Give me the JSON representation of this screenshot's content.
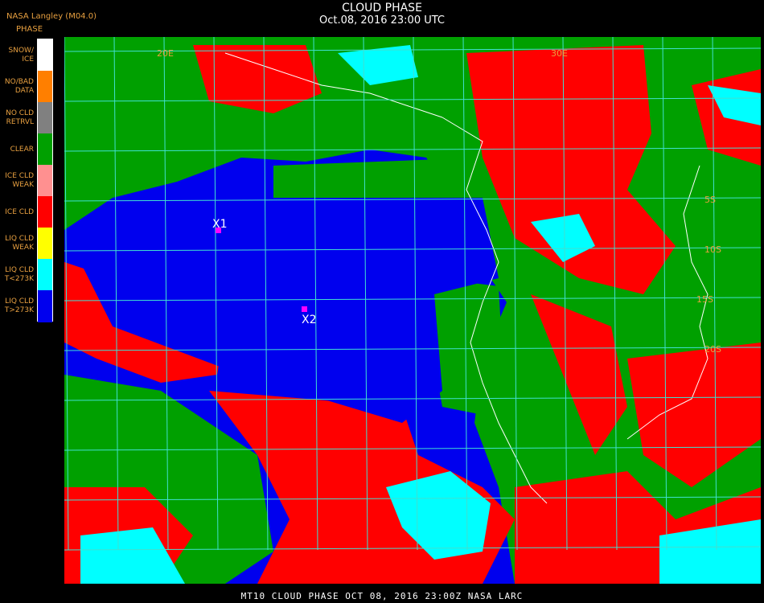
{
  "header": {
    "title": "CLOUD PHASE",
    "datetime": "Oct.08, 2016 23:00 UTC"
  },
  "source": "NASA Langley (M04.0)",
  "legend": {
    "title": "PHASE",
    "items": [
      {
        "label": "SNOW/\nICE",
        "color": "#ffffff"
      },
      {
        "label": "NO/BAD\nDATA",
        "color": "#ff7f00"
      },
      {
        "label": "NO CLD\nRETRVL",
        "color": "#808080"
      },
      {
        "label": "CLEAR",
        "color": "#00a000"
      },
      {
        "label": "ICE CLD\nWEAK",
        "color": "#ff9090"
      },
      {
        "label": "ICE CLD",
        "color": "#ff0000"
      },
      {
        "label": "LIQ CLD\nWEAK",
        "color": "#ffff00"
      },
      {
        "label": "LIQ CLD\nT<273K",
        "color": "#00ffff"
      },
      {
        "label": "LIQ CLD\nT>273K",
        "color": "#0000ee"
      }
    ]
  },
  "markers": [
    {
      "label": "X1",
      "color": "#ff00ff"
    },
    {
      "label": "X2",
      "color": "#ff00ff"
    }
  ],
  "grid_labels": [
    "20E",
    "30E",
    "5S",
    "10S",
    "15S",
    "20S"
  ],
  "colors": {
    "grid": "#40e0d0",
    "coast": "#ffffff",
    "label": "#e8a040"
  },
  "footer": "MT10   CLOUD PHASE   OCT 08, 2016 23:00Z   NASA LARC"
}
